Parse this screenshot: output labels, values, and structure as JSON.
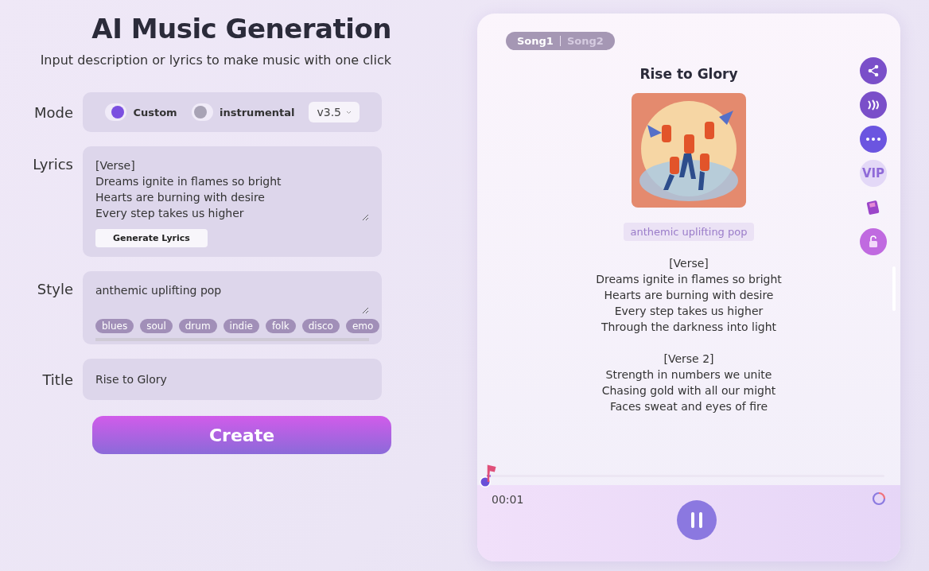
{
  "header": {
    "title": "AI Music Generation",
    "subtitle": "Input description or lyrics to make music with one click"
  },
  "form": {
    "mode": {
      "label": "Mode",
      "toggles": [
        {
          "label": "Custom",
          "on": true
        },
        {
          "label": "instrumental",
          "on": false
        }
      ],
      "version": "v3.5"
    },
    "lyrics": {
      "label": "Lyrics",
      "value": "[Verse]\nDreams ignite in flames so bright\nHearts are burning with desire\nEvery step takes us higher",
      "button": "Generate Lyrics"
    },
    "style": {
      "label": "Style",
      "value": "anthemic uplifting pop",
      "tags": [
        "blues",
        "soul",
        "drum",
        "indie",
        "folk",
        "disco",
        "emo"
      ]
    },
    "title": {
      "label": "Title",
      "value": "Rise to Glory"
    },
    "create": "Create"
  },
  "player": {
    "tabs": [
      {
        "label": "Song1",
        "selected": true
      },
      {
        "label": "Song2",
        "selected": false
      }
    ],
    "song_title": "Rise to Glory",
    "cover": {
      "kind": "picture"
    },
    "style_tag": "anthemic uplifting pop",
    "lyrics": [
      [
        "[Verse]",
        "Dreams ignite in flames so bright",
        "Hearts are burning with desire",
        "Every step takes us higher",
        "Through the darkness into light"
      ],
      [
        "[Verse 2]",
        "Strength in numbers we unite",
        "Chasing gold with all our might",
        "Faces sweat and eyes of fire"
      ]
    ],
    "actions": [
      {
        "kind": "share"
      },
      {
        "kind": "voice"
      },
      {
        "kind": "more"
      },
      {
        "kind": "vip",
        "label": "VIP"
      },
      {
        "kind": "book"
      },
      {
        "kind": "unlock"
      }
    ],
    "progress": {
      "level": 0.01
    },
    "time": "00:01",
    "playing": true
  }
}
